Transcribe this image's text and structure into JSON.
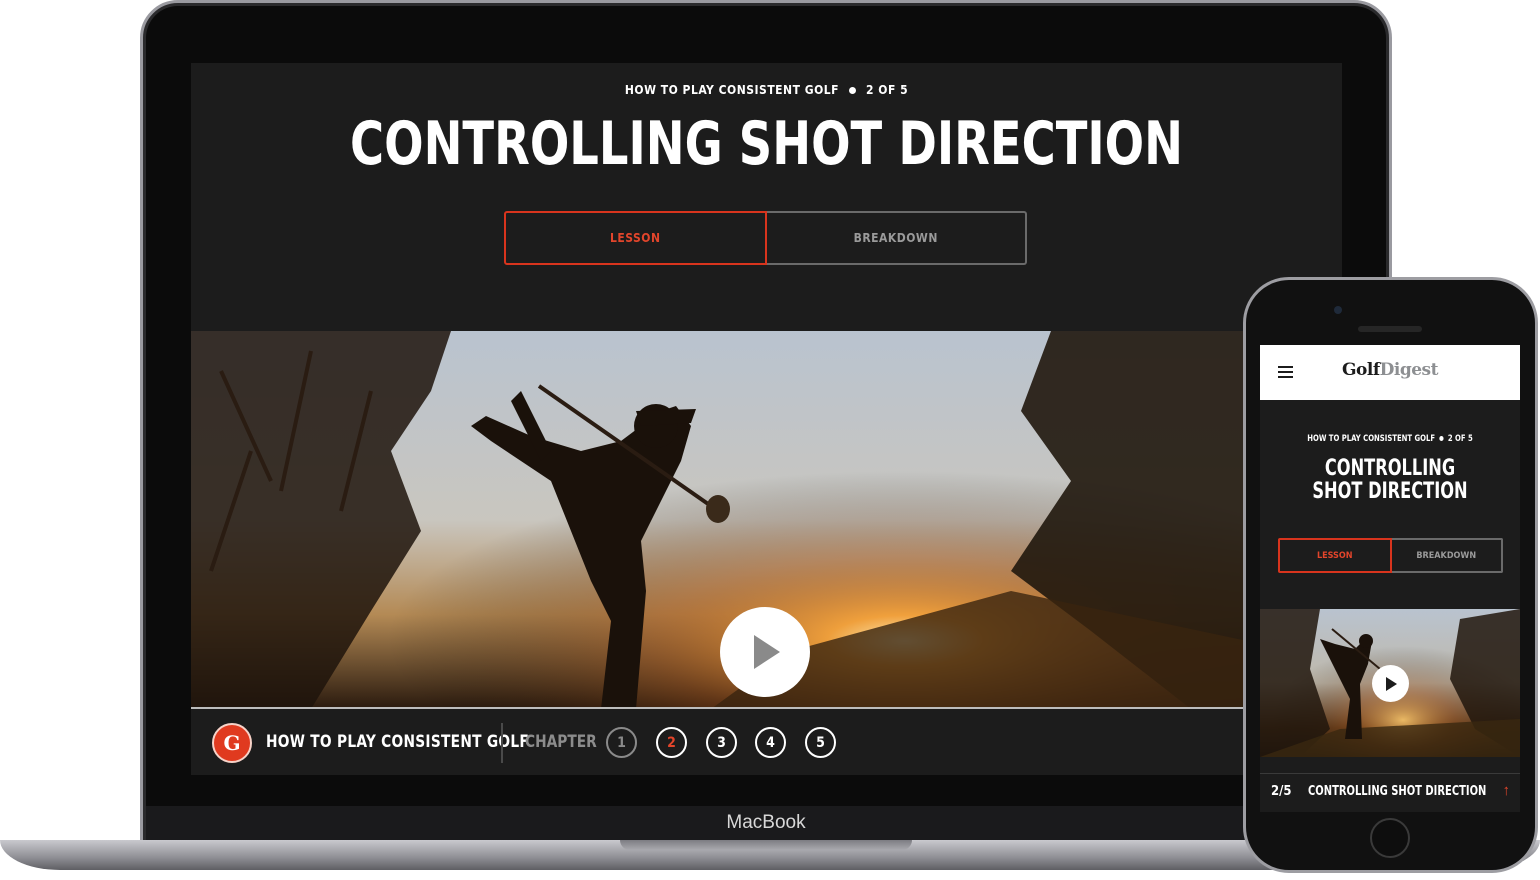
{
  "laptop": {
    "brand_label": "MacBook"
  },
  "lesson": {
    "series": "HOW TO PLAY CONSISTENT GOLF",
    "position": "2 OF 5",
    "title": "CONTROLLING SHOT DIRECTION",
    "tabs": [
      {
        "label": "LESSON",
        "active": true
      },
      {
        "label": "BREAKDOWN",
        "active": false
      }
    ]
  },
  "video": {
    "play_icon": "play-icon"
  },
  "footer": {
    "logo_letter": "G",
    "course": "HOW TO PLAY CONSISTENT GOLF",
    "chapter_label": "CHAPTER",
    "chapters": [
      "1",
      "2",
      "3",
      "4",
      "5"
    ],
    "current_chapter": "2"
  },
  "mobile": {
    "logo_golf": "Golf",
    "logo_digest": "Digest",
    "series": "HOW TO PLAY CONSISTENT GOLF",
    "position": "2 OF 5",
    "title": "CONTROLLING SHOT DIRECTION",
    "tabs": [
      {
        "label": "LESSON",
        "active": true
      },
      {
        "label": "BREAKDOWN",
        "active": false
      }
    ],
    "progress": "2/5",
    "current_lesson": "CONTROLLING SHOT DIRECTION",
    "arrow_icon": "arrow-up-icon"
  },
  "colors": {
    "accent": "#e2452b",
    "background": "#1c1c1c",
    "text": "#ffffff"
  }
}
